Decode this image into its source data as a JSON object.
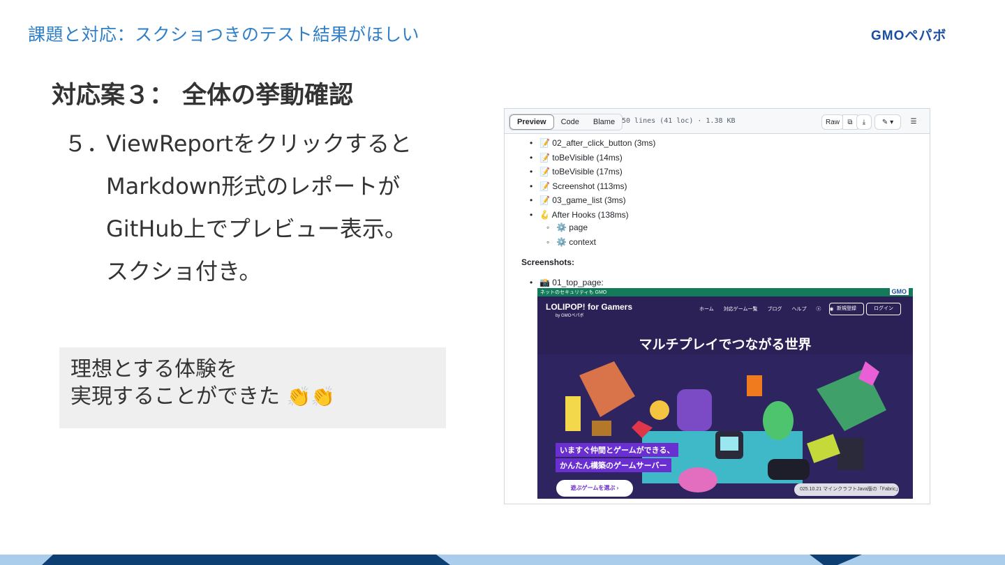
{
  "header": {
    "title": "課題と対応：スクショつきのテスト結果がほしい",
    "brand": "GMOペパボ"
  },
  "slide": {
    "title": "対応案３： 全体の挙動確認",
    "step_number": "５．",
    "step_lines": [
      "ViewReportをクリックすると",
      "Markdown形式のレポートが",
      "GitHub上でプレビュー表示。",
      "スクショ付き。"
    ],
    "callout_line1": "理想とする体験を",
    "callout_line2": "実現することができた",
    "callout_emoji": "👏👏"
  },
  "github": {
    "tabs": [
      "Preview",
      "Code",
      "Blame"
    ],
    "active_tab": "Preview",
    "file_meta": "50 lines (41 loc) · 1.38 KB",
    "raw_label": "Raw",
    "items": [
      {
        "icon": "📝",
        "text": "02_after_click_button (3ms)",
        "level": 1
      },
      {
        "icon": "📝",
        "text": "toBeVisible (14ms)",
        "level": 1
      },
      {
        "icon": "📝",
        "text": "toBeVisible (17ms)",
        "level": 1
      },
      {
        "icon": "📝",
        "text": "Screenshot (113ms)",
        "level": 1
      },
      {
        "icon": "📝",
        "text": "03_game_list (3ms)",
        "level": 1
      },
      {
        "icon": "🪝",
        "text": "After Hooks (138ms)",
        "level": 1
      },
      {
        "icon": "⚙️",
        "text": "page",
        "level": 2
      },
      {
        "icon": "⚙️",
        "text": "context",
        "level": 2
      }
    ],
    "screenshots_heading": "Screenshots:",
    "screenshot_item": {
      "icon": "📸",
      "text": "01_top_page:"
    }
  },
  "embedded_page": {
    "top_bar_text": "ネットのセキュリティも GMO",
    "top_bar_brand": "GMO",
    "logo": "LOLIPOP! for Gamers",
    "logo_sub": "by GMOペパボ",
    "nav": [
      "ホーム",
      "対応ゲーム一覧",
      "ブログ",
      "ヘルプ"
    ],
    "signup": "新規登録",
    "login": "ログイン",
    "headline": "マルチプレイでつながる世界",
    "tag1": "いますぐ仲間とゲームができる、",
    "tag2": "かんたん構築のゲームサーバー",
    "cta": "遊ぶゲームを選ぶ ›",
    "news": "025.10.21 マインクラフトJava版の「Fabric」"
  },
  "colors": {
    "header_blue": "#2e7fc8",
    "footer_light": "#a9cdea",
    "footer_dark": "#0d3f73",
    "callout_bg": "#efefef"
  }
}
